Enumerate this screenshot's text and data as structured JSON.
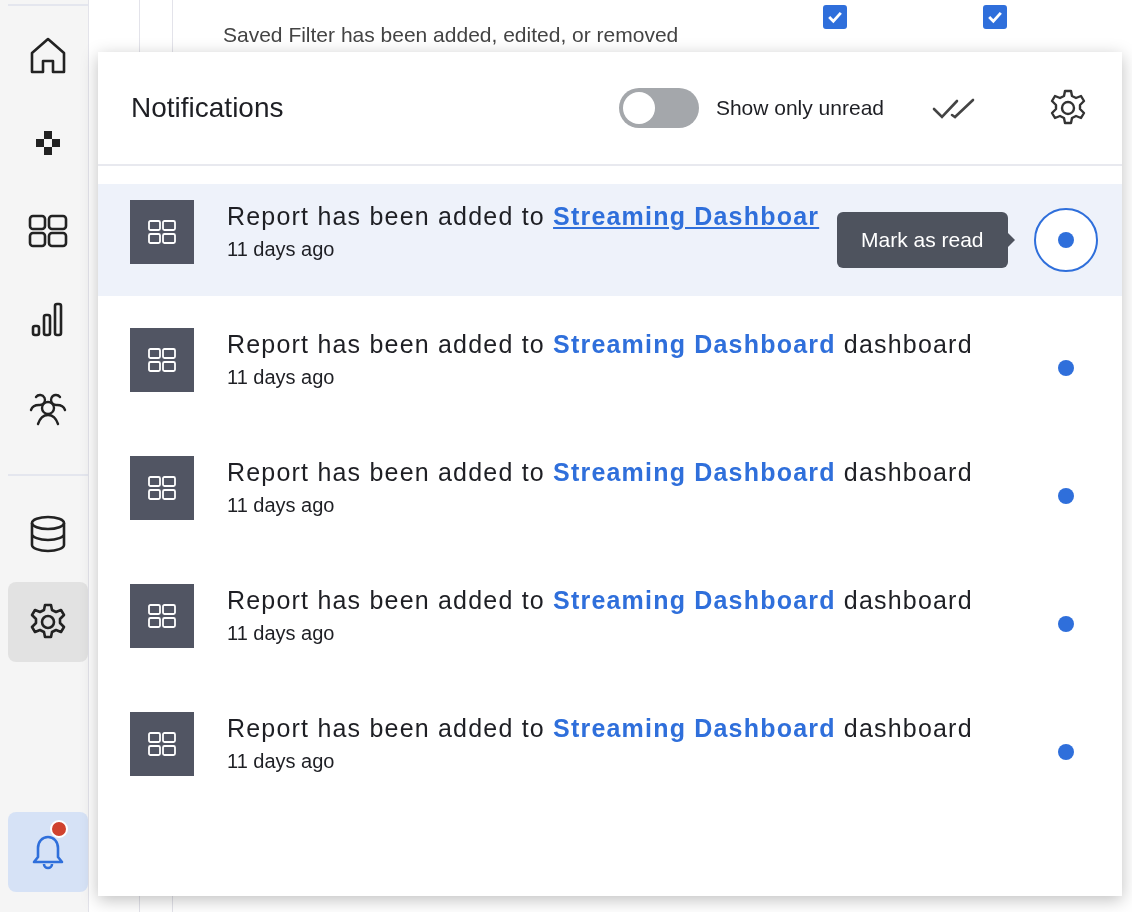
{
  "sidebar": {
    "items": [
      {
        "selected": false
      },
      {
        "selected": false
      },
      {
        "selected": false
      },
      {
        "selected": false
      },
      {
        "selected": false
      },
      {
        "selected": false
      },
      {
        "selected": true
      }
    ],
    "notifications": {
      "selected": true,
      "badge": true
    }
  },
  "background": {
    "rows": [
      {
        "label": "Saved Filter has been added, edited, or removed",
        "checks": [
          true,
          true
        ]
      }
    ]
  },
  "panel": {
    "title": "Notifications",
    "toggle": {
      "label": "Show only unread",
      "on": false
    },
    "items": [
      {
        "prefix": "Report has been added to ",
        "link": "Streaming Dashboar",
        "time": "11 days ago",
        "unread": true,
        "highlighted": true,
        "tooltip": "Mark as read"
      },
      {
        "prefix": "Report has been added to ",
        "link": "Streaming Dashboard",
        "suffix": " dashboard",
        "time": "11 days ago",
        "unread": true,
        "highlighted": false
      },
      {
        "prefix": "Report has been added to ",
        "link": "Streaming Dashboard",
        "suffix": " dashboard",
        "time": "11 days ago",
        "unread": true,
        "highlighted": false
      },
      {
        "prefix": "Report has been added to ",
        "link": "Streaming Dashboard",
        "suffix": " dashboard",
        "time": "11 days ago",
        "unread": true,
        "highlighted": false
      },
      {
        "prefix": "Report has been added to ",
        "link": "Streaming Dashboard",
        "suffix": " dashboard",
        "time": "11 days ago",
        "unread": true,
        "highlighted": false
      }
    ]
  }
}
